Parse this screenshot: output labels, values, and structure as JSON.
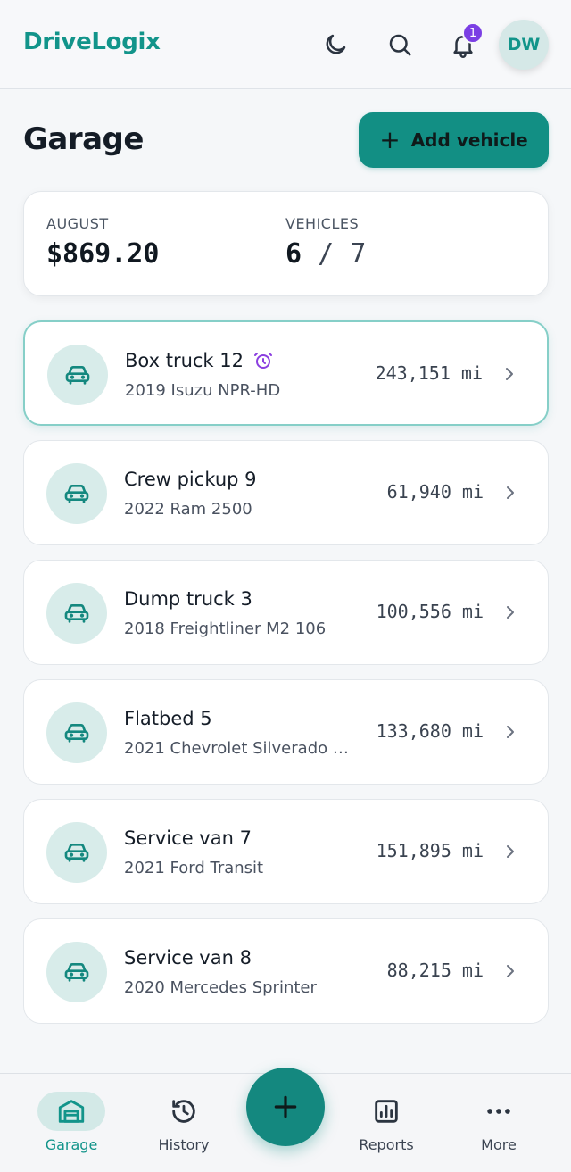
{
  "header": {
    "brand": "DriveLogix",
    "notifications_count": "1",
    "avatar_initials": "DW",
    "icons": [
      "moon-icon",
      "search-icon",
      "bell-icon"
    ]
  },
  "page": {
    "title": "Garage",
    "add_button_label": "Add vehicle"
  },
  "summary": {
    "month_label": "AUGUST",
    "month_value": "$869.20",
    "vehicles_label": "VEHICLES",
    "vehicles_active": "6",
    "vehicles_separator": "/",
    "vehicles_total": "7"
  },
  "vehicles": [
    {
      "name": "Box truck 12",
      "model": "2019 Isuzu NPR-HD",
      "miles": "243,151 mi",
      "alert": true
    },
    {
      "name": "Crew pickup 9",
      "model": "2022 Ram 2500",
      "miles": "61,940 mi",
      "alert": false
    },
    {
      "name": "Dump truck 3",
      "model": "2018 Freightliner M2 106",
      "miles": "100,556 mi",
      "alert": false
    },
    {
      "name": "Flatbed 5",
      "model": "2021 Chevrolet Silverado …",
      "miles": "133,680 mi",
      "alert": false
    },
    {
      "name": "Service van 7",
      "model": "2021 Ford Transit",
      "miles": "151,895 mi",
      "alert": false
    },
    {
      "name": "Service van 8",
      "model": "2020 Mercedes Sprinter",
      "miles": "88,215 mi",
      "alert": false
    }
  ],
  "bottom_nav": {
    "items": [
      {
        "label": "Garage",
        "icon": "garage-icon",
        "active": true
      },
      {
        "label": "History",
        "icon": "history-icon",
        "active": false
      },
      {
        "label": "Reports",
        "icon": "reports-icon",
        "active": false
      },
      {
        "label": "More",
        "icon": "more-icon",
        "active": false
      }
    ],
    "fab_icon": "plus-icon"
  },
  "colors": {
    "brand": "#12948a",
    "accent_button": "#128f84",
    "badge": "#7b3fe4",
    "alert_icon": "#8b3fe0"
  }
}
